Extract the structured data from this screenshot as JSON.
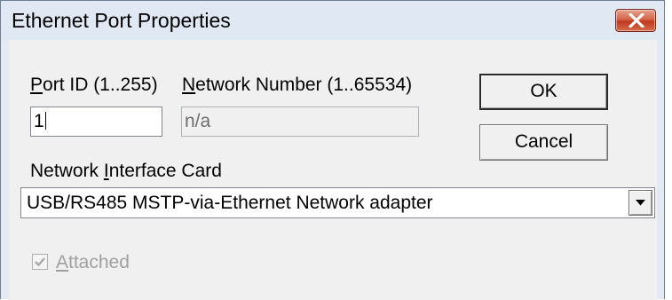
{
  "window": {
    "title": "Ethernet Port Properties"
  },
  "port_id": {
    "label_accel": "P",
    "label_rest": "ort ID (1..255)",
    "value": "1"
  },
  "network_number": {
    "label_accel": "N",
    "label_rest": "etwork Number (1..65534)",
    "value": "n/a"
  },
  "buttons": {
    "ok": "OK",
    "cancel": "Cancel"
  },
  "nic": {
    "label_pre": "Network ",
    "label_accel": "I",
    "label_post": "nterface Card",
    "selected": "USB/RS485 MSTP-via-Ethernet Network adapter"
  },
  "attached": {
    "label_accel": "A",
    "label_rest": "ttached",
    "checked": true,
    "enabled": false
  },
  "colors": {
    "close_button": "#c0391f",
    "dialog_bg": "#f0f0f0",
    "titlebar_bg": "#dfe8f3"
  }
}
